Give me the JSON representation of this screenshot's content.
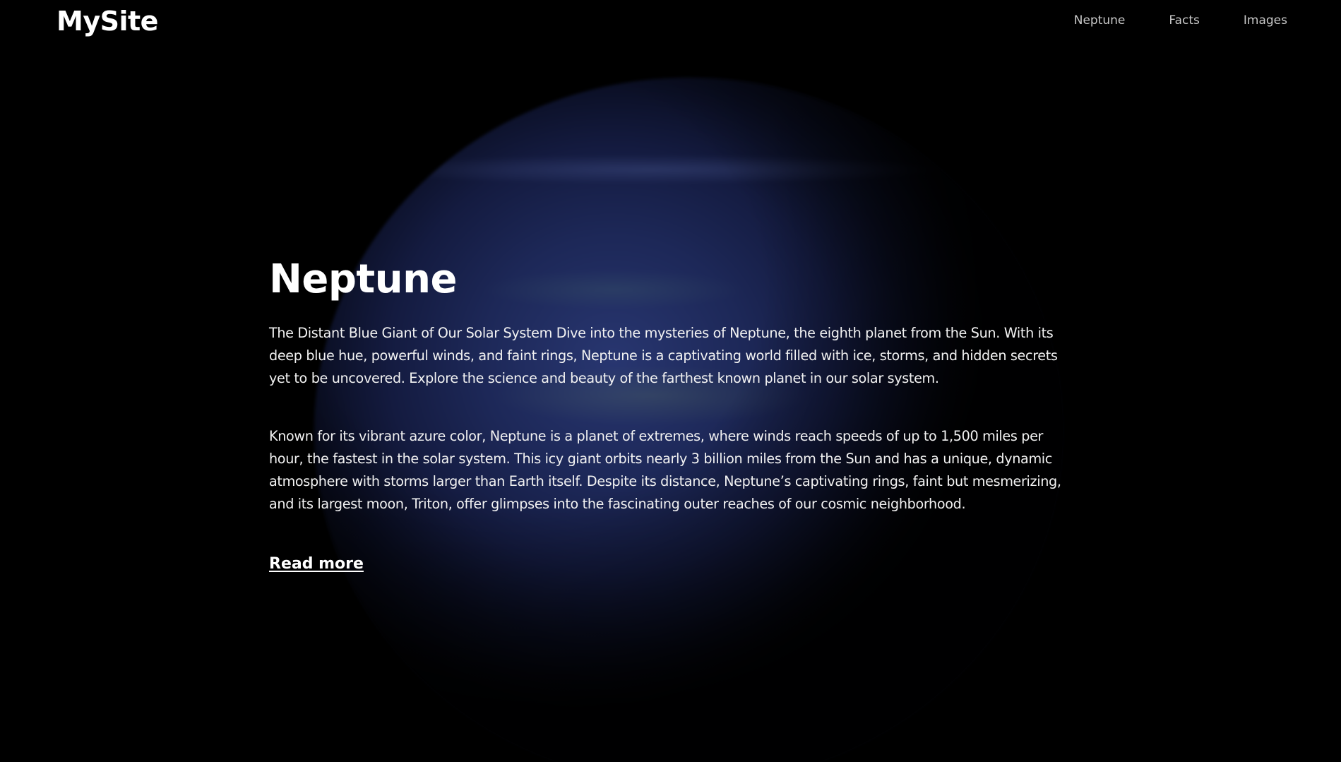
{
  "header": {
    "logo": "MySite",
    "nav": [
      {
        "label": "Neptune"
      },
      {
        "label": "Facts"
      },
      {
        "label": "Images"
      }
    ]
  },
  "hero": {
    "title": "Neptune",
    "paragraphs": [
      "The Distant Blue Giant of Our Solar System Dive into the mysteries of Neptune, the eighth planet from the Sun. With its deep blue hue, powerful winds, and faint rings, Neptune is a captivating world filled with ice, storms, and hidden secrets yet to be uncovered. Explore the science and beauty of the farthest known planet in our solar system.",
      "Known for its vibrant azure color, Neptune is a planet of extremes, where winds reach speeds of up to 1,500 miles per hour, the fastest in the solar system. This icy giant orbits nearly 3 billion miles from the Sun and has a unique, dynamic atmosphere with storms larger than Earth itself. Despite its distance, Neptune’s captivating rings, faint but mesmerizing, and its largest moon, Triton, offer glimpses into the fascinating outer reaches of our cosmic neighborhood."
    ],
    "read_more": "Read more"
  },
  "colors": {
    "background": "#000000",
    "text": "#ffffff",
    "nav_text": "#c9c9c9",
    "planet": "#1d2858"
  }
}
